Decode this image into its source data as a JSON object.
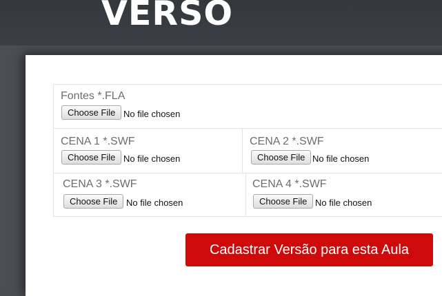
{
  "header": {
    "logo_text": "VERSO"
  },
  "form": {
    "fields": [
      {
        "label": "Fontes *.FLA",
        "button": "Choose File",
        "status": "No file chosen"
      },
      {
        "label": "CENA 1 *.SWF",
        "button": "Choose File",
        "status": "No file chosen"
      },
      {
        "label": "CENA 2 *.SWF",
        "button": "Choose File",
        "status": "No file chosen"
      },
      {
        "label": "CENA 3 *.SWF",
        "button": "Choose File",
        "status": "No file chosen"
      },
      {
        "label": "CENA 4 *.SWF",
        "button": "Choose File",
        "status": "No file chosen"
      }
    ],
    "submit_label": "Cadastrar Versão para esta Aula"
  },
  "colors": {
    "header_bg": "#373c41",
    "submit_bg": "#cf0a0a",
    "label_text": "#6d6d6d"
  }
}
